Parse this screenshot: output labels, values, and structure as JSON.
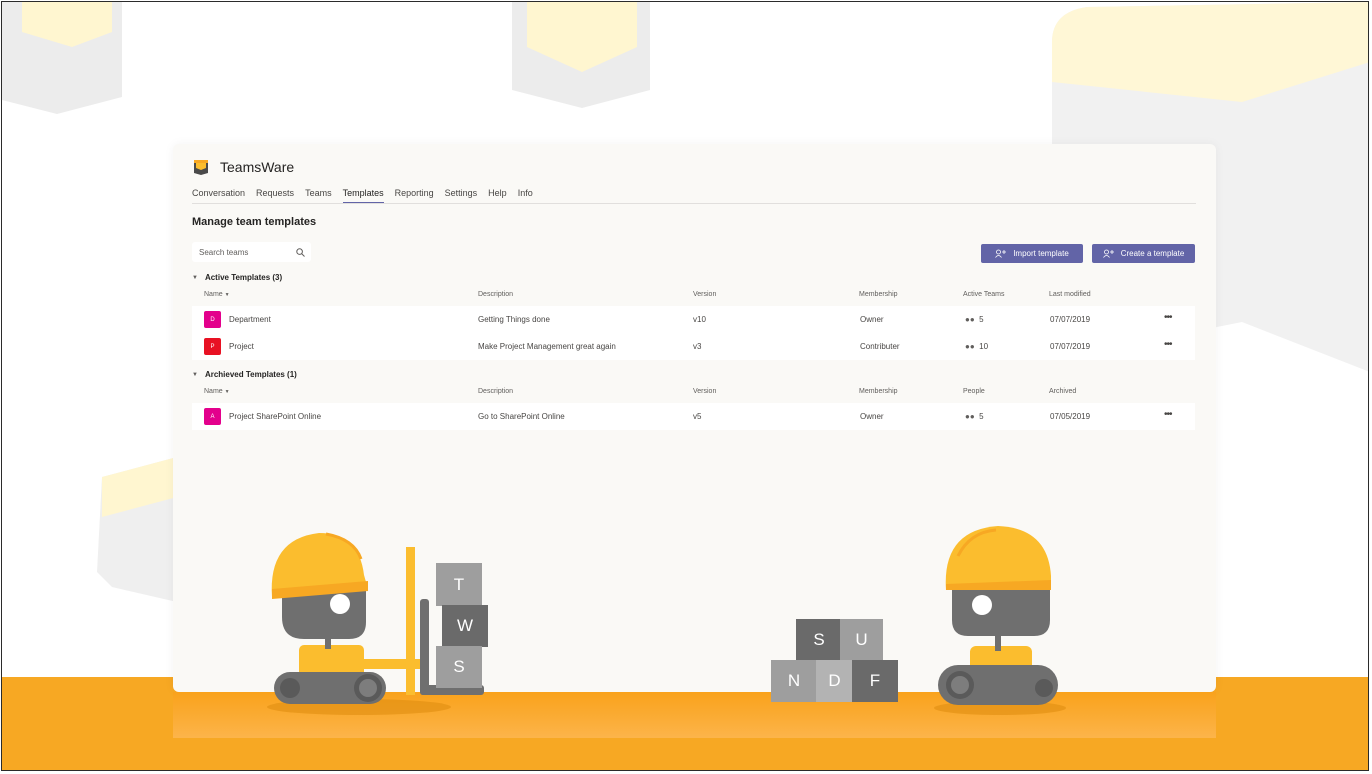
{
  "app": {
    "title": "TeamsWare"
  },
  "tabs": [
    "Conversation",
    "Requests",
    "Teams",
    "Templates",
    "Reporting",
    "Settings",
    "Help",
    "Info"
  ],
  "active_tab": "Templates",
  "page_title": "Manage team templates",
  "search": {
    "placeholder": "Search teams"
  },
  "buttons": {
    "import": "Import template",
    "create": "Create a template"
  },
  "active_section": {
    "title": "Active Templates (3)",
    "headers": [
      "Name",
      "Description",
      "Version",
      "Membership",
      "Active Teams",
      "Last modified"
    ],
    "rows": [
      {
        "initial": "D",
        "name": "Department",
        "description": "Getting Things done",
        "version": "v10",
        "membership": "Owner",
        "count": "5",
        "date": "07/07/2019",
        "color": "#e3008c"
      },
      {
        "initial": "P",
        "name": "Project",
        "description": "Make Project Management great again",
        "version": "v3",
        "membership": "Contributer",
        "count": "10",
        "date": "07/07/2019",
        "color": "#e81123"
      }
    ]
  },
  "archived_section": {
    "title": "Archieved Templates (1)",
    "headers": [
      "Name",
      "Description",
      "Version",
      "Membership",
      "People",
      "Archived"
    ],
    "rows": [
      {
        "initial": "A",
        "name": "Project SharePoint Online",
        "description": "Go to SharePoint Online",
        "version": "v5",
        "membership": "Owner",
        "count": "5",
        "date": "07/05/2019",
        "color": "#e3008c"
      }
    ]
  },
  "blocks_left": [
    "T",
    "W",
    "S"
  ],
  "blocks_right": [
    "S",
    "U",
    "N",
    "D",
    "F"
  ],
  "colors": {
    "accent": "#6264a7",
    "orange": "#f7a823",
    "helmet": "#fbbd2e",
    "robot_gray": "#6f6f6f"
  }
}
